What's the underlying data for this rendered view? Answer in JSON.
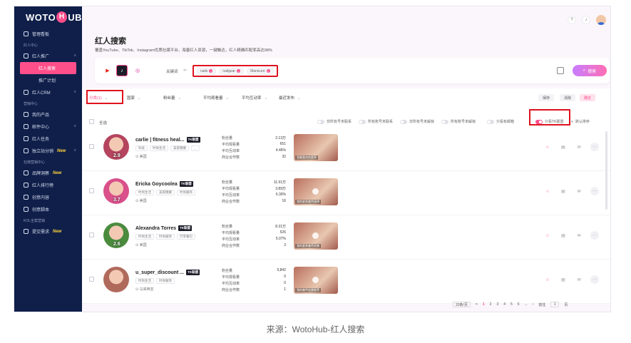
{
  "sidebar": {
    "logo_left": "WOTO",
    "logo_mid": "H",
    "logo_right": "UB",
    "items": [
      {
        "type": "item",
        "label": "管理看板",
        "icon": "dashboard-icon"
      },
      {
        "type": "group",
        "label": "红人中心"
      },
      {
        "type": "item",
        "label": "红人推广",
        "icon": "user-icon",
        "chev": "˄"
      },
      {
        "type": "sub",
        "label": "红人搜索",
        "active": true
      },
      {
        "type": "sub",
        "label": "推广计划",
        "active": false
      },
      {
        "type": "item",
        "label": "红人CRM",
        "icon": "user-icon",
        "chev": "˅"
      },
      {
        "type": "group",
        "label": "营销中心"
      },
      {
        "type": "item",
        "label": "我的产品",
        "icon": "box-icon"
      },
      {
        "type": "item",
        "label": "邮件中心",
        "icon": "mail-icon",
        "chev": "˅"
      },
      {
        "type": "item",
        "label": "红人任务",
        "icon": "task-icon"
      },
      {
        "type": "item",
        "label": "独立站分销",
        "icon": "user-icon",
        "badge": "New",
        "chev": "˅"
      },
      {
        "type": "group",
        "label": "社媒营销中心"
      },
      {
        "type": "item",
        "label": "品牌洞察",
        "icon": "diamond-icon",
        "badge": "New"
      },
      {
        "type": "item",
        "label": "红人排行榜",
        "icon": "diamond-icon"
      },
      {
        "type": "item",
        "label": "创意内容",
        "icon": "location-icon"
      },
      {
        "type": "item",
        "label": "创意脚本",
        "icon": "script-icon"
      },
      {
        "type": "group",
        "label": "KOL全案营销"
      },
      {
        "type": "item",
        "label": "提交需求",
        "icon": "form-icon",
        "badge": "New"
      }
    ]
  },
  "header": {
    "title": "红人搜索",
    "subtitle": "覆盖YouTube、TikTok、Instagram优质社媒平台，海量红人资源，一键触达，红人精确匹配率高达98%"
  },
  "search": {
    "keyword_label": "关键词",
    "keyword_sep": "⇌",
    "tags": [
      "nails",
      "nailgear",
      "Manicure"
    ],
    "button_label": "搜索"
  },
  "filters": {
    "items": [
      "分类(1)",
      "国家",
      "粉丝量",
      "平均观看量",
      "平均互动率",
      "最近发布"
    ],
    "save": "保存",
    "clear": "清除",
    "confirm": "确定"
  },
  "select_all": "全选",
  "toggles": [
    {
      "label": "非所有号未联系",
      "on": false
    },
    {
      "label": "所有账号未联系",
      "on": false
    },
    {
      "label": "非所有号未解锁",
      "on": false
    },
    {
      "label": "所有账号未解锁",
      "on": false
    },
    {
      "label": "只看有邮箱",
      "on": false
    },
    {
      "label": "只看TK联盟",
      "on": true
    },
    {
      "label": "默认排序",
      "on": false
    }
  ],
  "stat_labels": [
    "粉丝量",
    "平均观看量",
    "平均互动率",
    "商业合作数"
  ],
  "rows": [
    {
      "name": "carlie | fitness heal...",
      "badge": "TK联盟",
      "score": "2.9",
      "tags": [
        "科技",
        "时尚生活",
        "美容健康",
        "..."
      ],
      "country": "美国",
      "stats": [
        "2.13万",
        "651",
        "4.46%",
        "32"
      ],
      "thumb_caption": "我最喜欢的夏季",
      "color": "#b5455e"
    },
    {
      "name": "Ericka Goycoolea",
      "badge": "TK联盟",
      "score": "3.7",
      "tags": [
        "时尚生活",
        "美容健康",
        "时尚服饰"
      ],
      "country": "美国",
      "stats": [
        "11.91万",
        "3.89万",
        "6.30%",
        "16"
      ],
      "thumb_caption": "我的夏季美甲选择",
      "color": "#d9508a"
    },
    {
      "name": "Alexandra Torres",
      "badge": "TK联盟",
      "score": "2.6",
      "tags": [
        "时尚生活",
        "时尚服饰",
        "行李箱包"
      ],
      "country": "美国",
      "stats": [
        "8.31万",
        "526",
        "5.07%",
        "3"
      ],
      "thumb_caption": "我的夏季美甲灵感",
      "color": "#4a8b3e"
    },
    {
      "name": "u_super_discount ...",
      "badge": "TK联盟",
      "score": "",
      "tags": [
        "时尚生活",
        "时尚服饰"
      ],
      "country": "马来西亚",
      "stats": [
        "5,842",
        "0",
        "0",
        "1"
      ],
      "thumb_caption": "我的美甲创意推荐",
      "color": "#b06a5c"
    }
  ],
  "pager": {
    "page_size": "20条/页",
    "prev": "<",
    "pages": [
      "1",
      "2",
      "3",
      "4",
      "5",
      "6",
      "...",
      "›"
    ],
    "goto_label": "前往",
    "goto_value": "1",
    "goto_suffix": "页"
  },
  "caption": "来源：WotoHub-红人搜索",
  "colors": {
    "sidebar_bg": "#0f1f4a",
    "accent": "#ff4f8b",
    "highlight_box": "#e0121f"
  }
}
